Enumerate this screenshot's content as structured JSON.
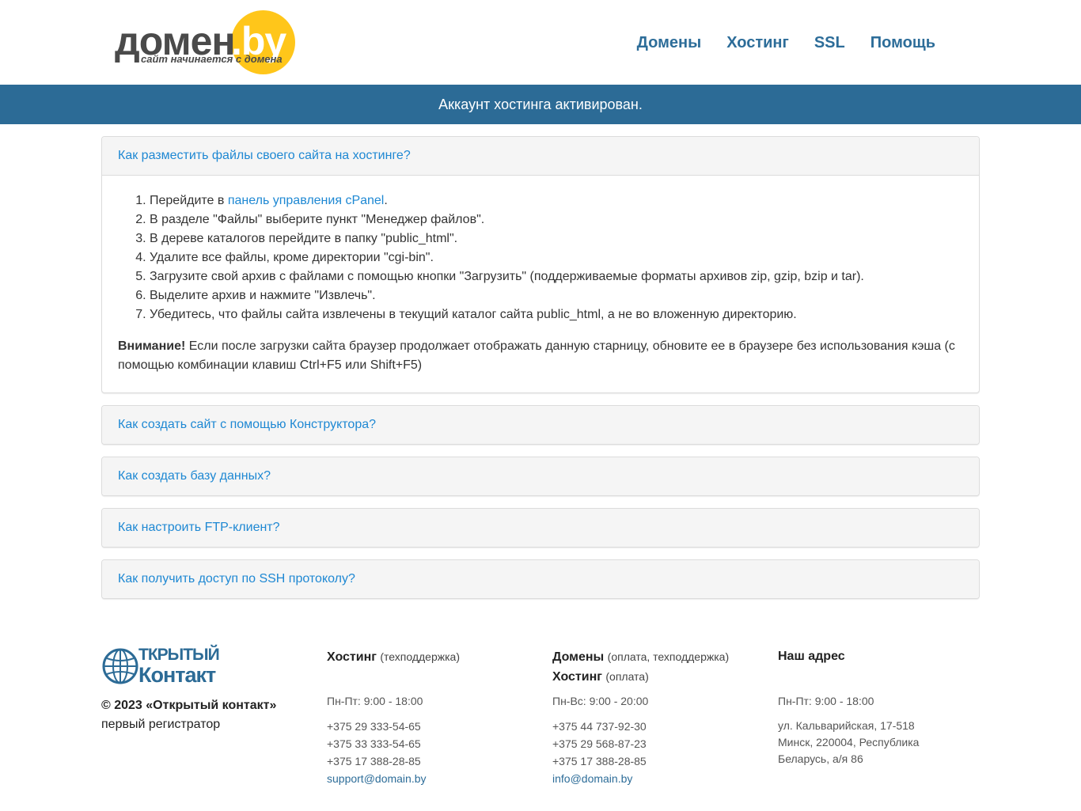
{
  "brand": {
    "logo_word": "домен",
    "logo_by": ".by",
    "tagline": "сайт начинается с домена",
    "colors": {
      "primary": "#2c6b96",
      "link": "#1e88d3",
      "yellow": "#ffc61a"
    }
  },
  "nav": {
    "items": [
      {
        "label": "Домены"
      },
      {
        "label": "Хостинг"
      },
      {
        "label": "SSL"
      },
      {
        "label": "Помощь"
      }
    ]
  },
  "banner": {
    "text": "Аккаунт хостинга активирован."
  },
  "panels": {
    "p1": {
      "title": "Как разместить файлы своего сайта на хостинге?",
      "step1_prefix": "Перейдите в ",
      "step1_link": "панель управления cPanel",
      "step1_suffix": ".",
      "steps": [
        "В разделе \"Файлы\" выберите пункт \"Менеджер файлов\".",
        "В дереве каталогов перейдите в папку \"public_html\".",
        "Удалите все файлы, кроме директории \"cgi-bin\".",
        "Загрузите свой архив с файлами с помощью кнопки \"Загрузить\" (поддерживаемые форматы архивов zip, gzip, bzip и tar).",
        "Выделите архив и нажмите \"Извлечь\".",
        "Убедитесь, что файлы сайта извлечены в текущий каталог сайта public_html, а не во вложенную директорию."
      ],
      "warning_label": "Внимание!",
      "warning_text": " Если после загрузки сайта браузер продолжает отображать данную старницу, обновите ее в браузере без использования кэша (с помощью комбинации клавиш Ctrl+F5 или Shift+F5)"
    },
    "p2": {
      "title": "Как создать сайт с помощью Конструктора?"
    },
    "p3": {
      "title": "Как создать базу данных?"
    },
    "p4": {
      "title": "Как настроить FTP-клиент?"
    },
    "p5": {
      "title": "Как получить доступ по SSH протоколу?"
    }
  },
  "footer": {
    "company_logo_line1": "ТКРЫТЫЙ",
    "company_logo_line2": "Контакт",
    "copyright": "© 2023 «Открытый контакт»",
    "company_desc": "первый регистратор",
    "hosting": {
      "title": "Хостинг",
      "subtitle": "(техподдержка)",
      "hours": "Пн-Пт: 9:00 - 18:00",
      "phones": [
        "+375 29 333-54-65",
        "+375 33 333-54-65",
        "+375 17 388-28-85"
      ],
      "email": "support@domain.by"
    },
    "domains": {
      "title": "Домены",
      "subtitle": "(оплата, техподдержка)",
      "title2": "Хостинг",
      "subtitle2": "(оплата)",
      "hours": "Пн-Вс: 9:00 - 20:00",
      "phones": [
        "+375 44 737-92-30",
        "+375 29 568-87-23",
        "+375 17 388-28-85"
      ],
      "email": "info@domain.by"
    },
    "address": {
      "title": "Наш адрес",
      "hours": "Пн-Пт: 9:00 - 18:00",
      "text": "ул. Кальварийская, 17-518 Минск, 220004, Республика Беларусь, а/я 86"
    }
  }
}
